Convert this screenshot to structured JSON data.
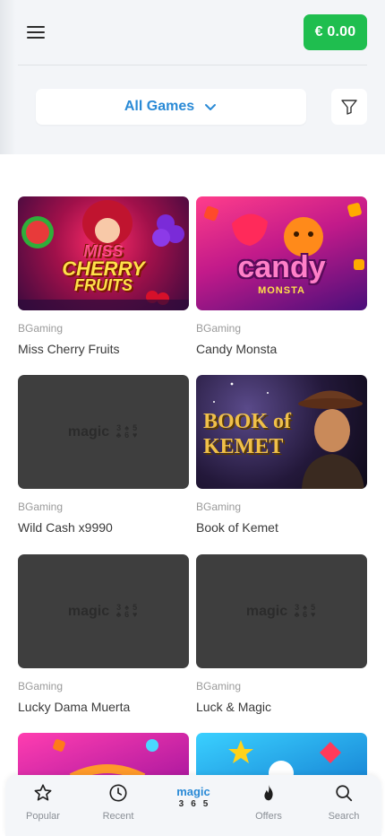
{
  "header": {
    "menu_icon": "hamburger-menu-icon",
    "balance": "€ 0.00",
    "balance_color": "#1fbe4f"
  },
  "filters": {
    "category": "All Games",
    "filter_icon": "filter-funnel-icon"
  },
  "games": [
    {
      "provider": "BGaming",
      "title": "Miss Cherry Fruits",
      "art_text": [
        "MISS",
        "CHERRY",
        "FRUITS"
      ]
    },
    {
      "provider": "BGaming",
      "title": "Candy Monsta",
      "art_text": [
        "candy",
        "MONSTA"
      ]
    },
    {
      "provider": "BGaming",
      "title": "Wild Cash x9990"
    },
    {
      "provider": "BGaming",
      "title": "Book of Kemet",
      "art_text": [
        "BOOK of",
        "KEMET"
      ]
    },
    {
      "provider": "BGaming",
      "title": "Lucky Dama Muerta"
    },
    {
      "provider": "BGaming",
      "title": "Luck & Magic"
    }
  ],
  "placeholder_logo": {
    "word": "magic",
    "digits": [
      "3",
      "6",
      "5"
    ]
  },
  "bottom_nav": {
    "popular": "Popular",
    "recent": "Recent",
    "logo_word": "magic",
    "logo_digits": [
      "3",
      "6",
      "5"
    ],
    "offers": "Offers",
    "search": "Search"
  },
  "colors": {
    "accent": "#2a8ad6",
    "placeholder": "#3e3e3e"
  }
}
